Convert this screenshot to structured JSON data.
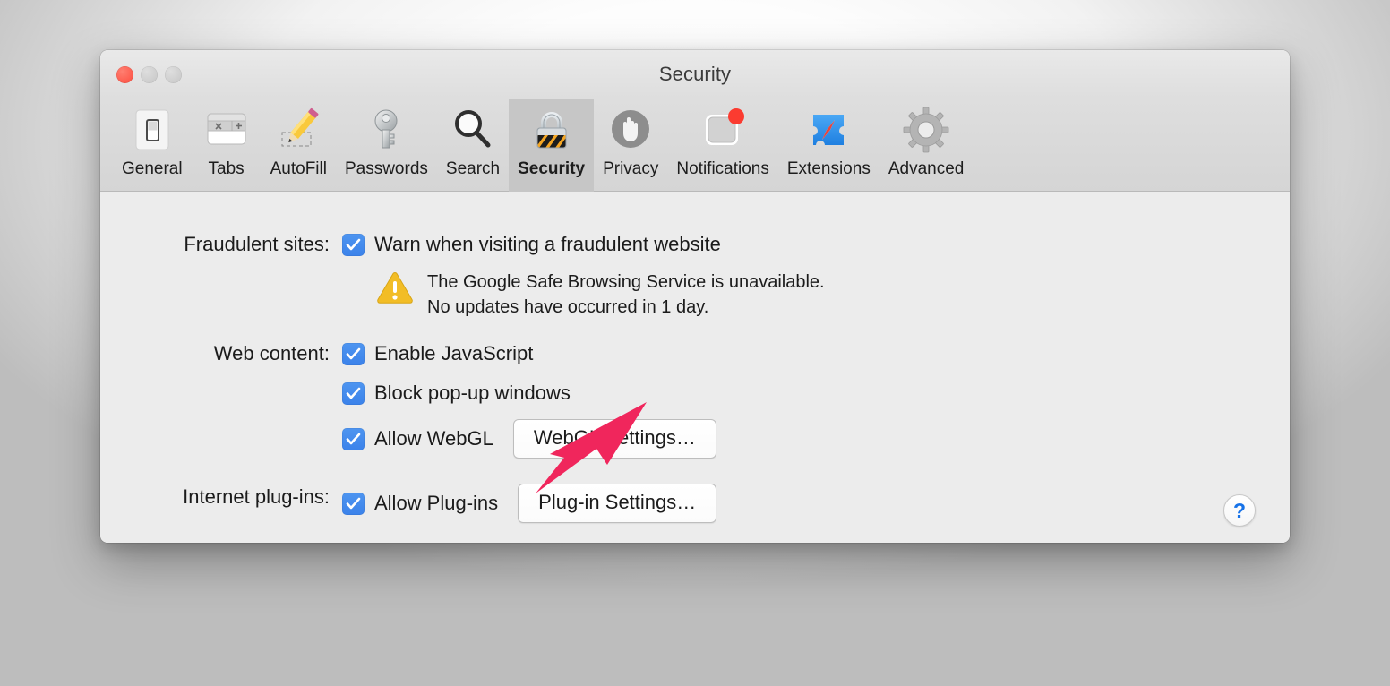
{
  "window": {
    "title": "Security",
    "traffic_lights": [
      {
        "name": "close",
        "color": "#fd5b4d"
      },
      {
        "name": "minimize",
        "color": "#cdcdcd"
      },
      {
        "name": "zoom",
        "color": "#cdcdcd"
      }
    ]
  },
  "toolbar": {
    "tabs": [
      {
        "label": "General",
        "icon": "light-switch-icon",
        "selected": false
      },
      {
        "label": "Tabs",
        "icon": "browser-tabs-icon",
        "selected": false
      },
      {
        "label": "AutoFill",
        "icon": "pencil-icon",
        "selected": false
      },
      {
        "label": "Passwords",
        "icon": "key-icon",
        "selected": false
      },
      {
        "label": "Search",
        "icon": "magnifier-icon",
        "selected": false
      },
      {
        "label": "Security",
        "icon": "padlock-icon",
        "selected": true
      },
      {
        "label": "Privacy",
        "icon": "hand-icon",
        "selected": false
      },
      {
        "label": "Notifications",
        "icon": "notification-badge-icon",
        "selected": false
      },
      {
        "label": "Extensions",
        "icon": "puzzle-compass-icon",
        "selected": false
      },
      {
        "label": "Advanced",
        "icon": "gear-icon",
        "selected": false
      }
    ]
  },
  "content": {
    "fraudulent": {
      "label": "Fraudulent sites:",
      "checkbox_label": "Warn when visiting a fraudulent website",
      "checked": true,
      "warning_icon": "warning-triangle-icon",
      "warning_line1": "The Google Safe Browsing Service is unavailable.",
      "warning_line2": "No updates have occurred in 1 day."
    },
    "web_content": {
      "label": "Web content:",
      "items": [
        {
          "checkbox_label": "Enable JavaScript",
          "checked": true,
          "button": null
        },
        {
          "checkbox_label": "Block pop-up windows",
          "checked": true,
          "button": null
        },
        {
          "checkbox_label": "Allow WebGL",
          "checked": true,
          "button": "WebGL Settings…"
        }
      ]
    },
    "plugins": {
      "label": "Internet plug-ins:",
      "checkbox_label": "Allow Plug-ins",
      "checked": true,
      "button": "Plug-in Settings…"
    },
    "help_button": {
      "label": "?",
      "icon": "help-question-icon"
    }
  },
  "annotation": {
    "type": "arrow",
    "color": "#f0265c",
    "points_at": "allow-plug-ins-checkbox"
  }
}
